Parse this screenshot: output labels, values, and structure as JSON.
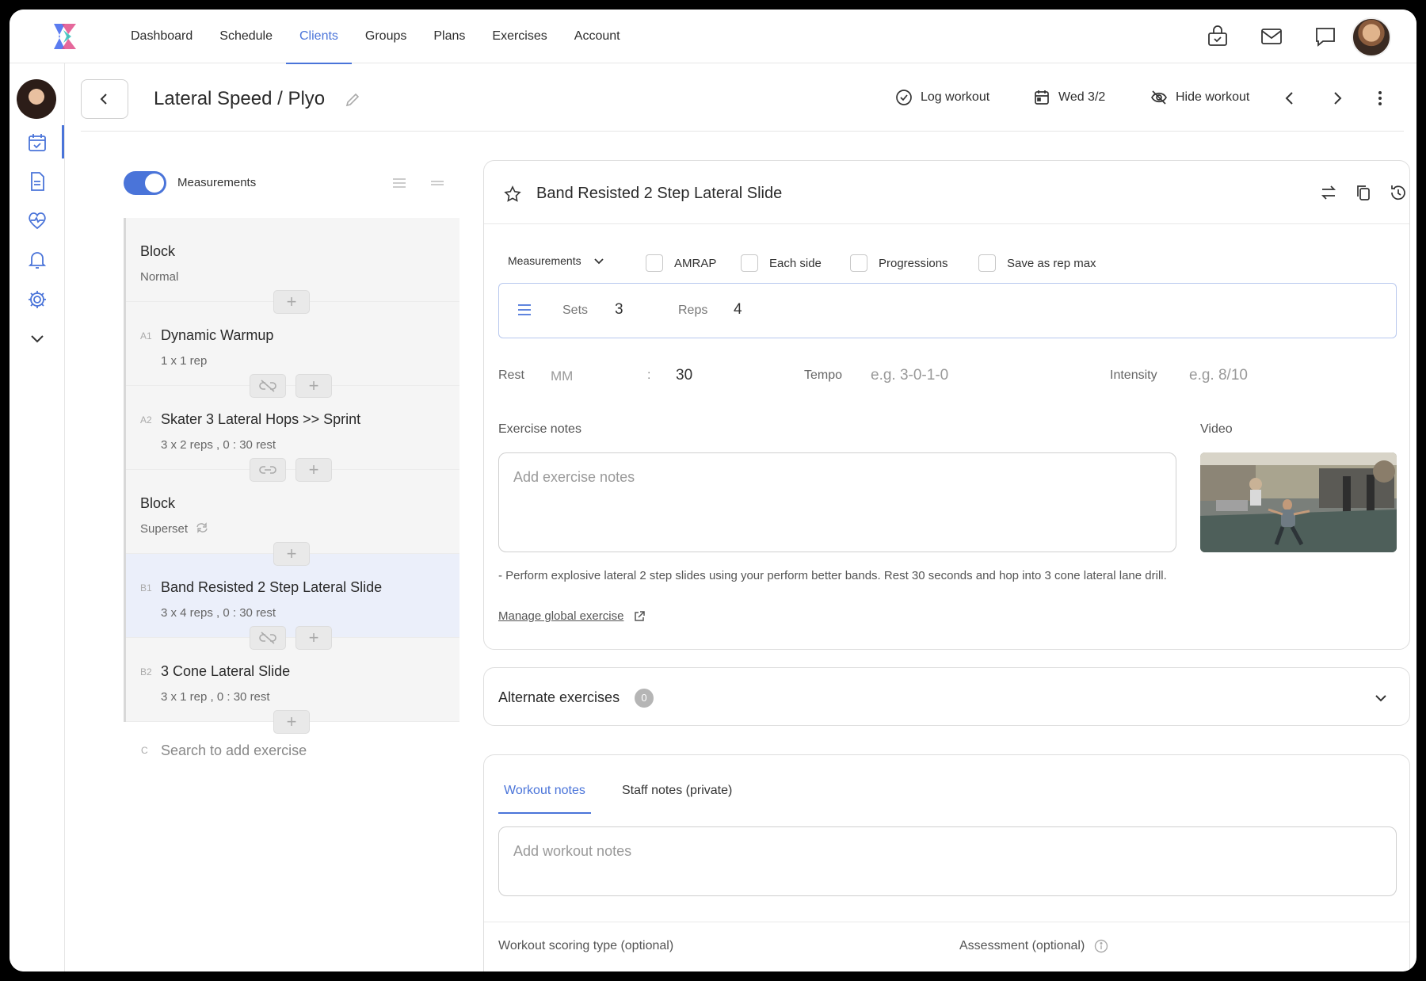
{
  "nav": {
    "links": [
      {
        "label": "Dashboard"
      },
      {
        "label": "Schedule"
      },
      {
        "label": "Clients",
        "active": true
      },
      {
        "label": "Groups"
      },
      {
        "label": "Plans"
      },
      {
        "label": "Exercises"
      },
      {
        "label": "Account"
      }
    ],
    "icons": [
      "store-icon",
      "mail-icon",
      "chat-icon"
    ]
  },
  "rail": {
    "icons": [
      "calendar-check-icon",
      "document-icon",
      "heart-pulse-icon",
      "bell-icon",
      "gear-icon",
      "chevron-down-icon"
    ]
  },
  "header": {
    "title": "Lateral Speed / Plyo",
    "log_workout": "Log workout",
    "date": "Wed 3/2",
    "hide_workout": "Hide workout"
  },
  "left": {
    "measurements_label": "Measurements",
    "measurements_on": true,
    "items": [
      {
        "type": "block",
        "name": "Block",
        "sub": "Normal"
      },
      {
        "type": "exercise",
        "code": "A1",
        "name": "Dynamic Warmup",
        "sub": "1 x 1 rep"
      },
      {
        "type": "exercise",
        "code": "A2",
        "name": "Skater 3 Lateral Hops >> Sprint",
        "sub": "3 x 2 reps ,  0 : 30 rest"
      },
      {
        "type": "block",
        "name": "Block",
        "sub": "Superset"
      },
      {
        "type": "exercise",
        "code": "B1",
        "name": "Band Resisted 2 Step Lateral Slide",
        "sub": "3 x 4 reps ,  0 : 30 rest",
        "selected": true
      },
      {
        "type": "exercise",
        "code": "B2",
        "name": "3 Cone Lateral Slide",
        "sub": "3 x 1 rep ,  0 : 30 rest"
      }
    ],
    "search_code": "C",
    "search_placeholder": "Search to add exercise"
  },
  "exercise": {
    "title": "Band Resisted 2 Step Lateral Slide",
    "measurements_dropdown": "Measurements",
    "options": [
      "AMRAP",
      "Each side",
      "Progressions",
      "Save as rep max"
    ],
    "sets_label": "Sets",
    "sets": "3",
    "reps_label": "Reps",
    "reps": "4",
    "rest_label": "Rest",
    "rest_mm_placeholder": "MM",
    "rest_colon": ":",
    "rest_ss": "30",
    "tempo_label": "Tempo",
    "tempo_placeholder": "e.g. 3-0-1-0",
    "intensity_label": "Intensity",
    "intensity_placeholder": "e.g. 8/10",
    "notes_label": "Exercise notes",
    "notes_placeholder": "Add exercise notes",
    "video_label": "Video",
    "description": "- Perform explosive lateral 2 step slides using your perform better bands. Rest 30 seconds and hop into 3 cone lateral lane drill.",
    "manage_link": "Manage global exercise"
  },
  "alternates": {
    "title": "Alternate exercises",
    "count": "0"
  },
  "notes": {
    "tab_workout": "Workout notes",
    "tab_staff": "Staff notes (private)",
    "placeholder": "Add workout notes",
    "scoring_label": "Workout scoring type (optional)",
    "assessment_label": "Assessment (optional)"
  },
  "colors": {
    "accent": "#4a74d9",
    "selected_bg": "#ebeffa"
  }
}
